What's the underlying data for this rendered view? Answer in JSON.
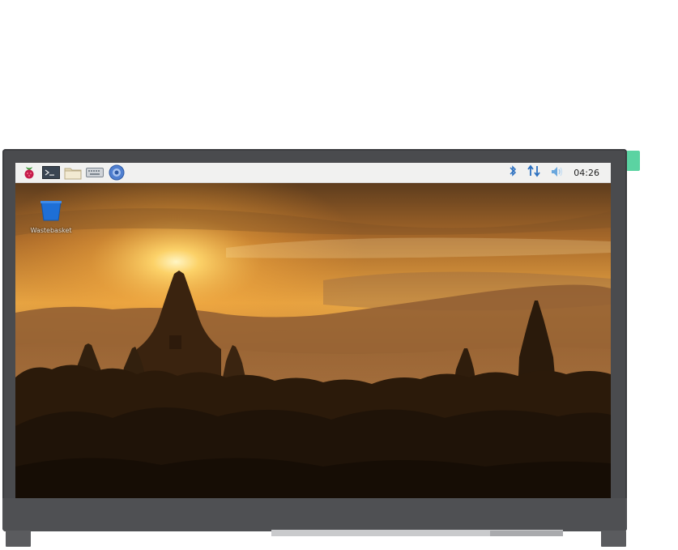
{
  "taskbar": {
    "launchers": [
      {
        "icon": "raspberry-menu-icon"
      },
      {
        "icon": "terminal-icon"
      },
      {
        "icon": "file-manager-icon"
      },
      {
        "icon": "keyboard-icon"
      },
      {
        "icon": "web-browser-icon"
      }
    ],
    "tray": {
      "bluetooth_icon": "bluetooth-icon",
      "network_icon": "network-arrows-icon",
      "volume_icon": "volume-icon",
      "clock": "04:26"
    }
  },
  "desktop": {
    "icons": [
      {
        "icon": "wastebasket-icon",
        "label": "Wastebasket"
      }
    ]
  },
  "colors": {
    "bezel": "#4a4b4e",
    "taskbar": "#f1f1f0",
    "accent_tab": "#5bd3a2",
    "sky_top": "#5d3c1d",
    "sun": "#fff2b0"
  }
}
